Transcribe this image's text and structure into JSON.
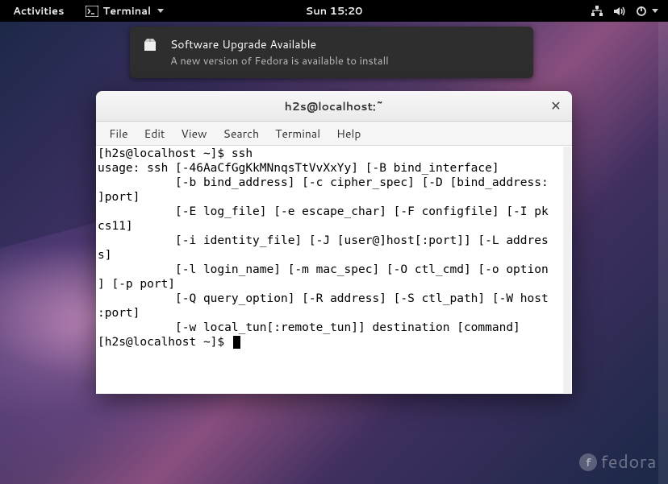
{
  "topbar": {
    "activities": "Activities",
    "app_label": "Terminal",
    "clock": "Sun 15:20"
  },
  "notification": {
    "title": "Software Upgrade Available",
    "body": "A new version of Fedora is available to install"
  },
  "terminal_window": {
    "title": "h2s@localhost:~",
    "menus": [
      "File",
      "Edit",
      "View",
      "Search",
      "Terminal",
      "Help"
    ],
    "lines": [
      "[h2s@localhost ~]$ ssh",
      "usage: ssh [-46AaCfGgKkMNnqsTtVvXxYy] [-B bind_interface]",
      "           [-b bind_address] [-c cipher_spec] [-D [bind_address:",
      "]port]",
      "           [-E log_file] [-e escape_char] [-F configfile] [-I pk",
      "cs11]",
      "           [-i identity_file] [-J [user@]host[:port]] [-L addres",
      "s]",
      "           [-l login_name] [-m mac_spec] [-O ctl_cmd] [-o option",
      "] [-p port]",
      "           [-Q query_option] [-R address] [-S ctl_path] [-W host",
      ":port]",
      "           [-w local_tun[:remote_tun]] destination [command]",
      "[h2s@localhost ~]$ "
    ]
  },
  "branding": {
    "distro": "fedora"
  }
}
